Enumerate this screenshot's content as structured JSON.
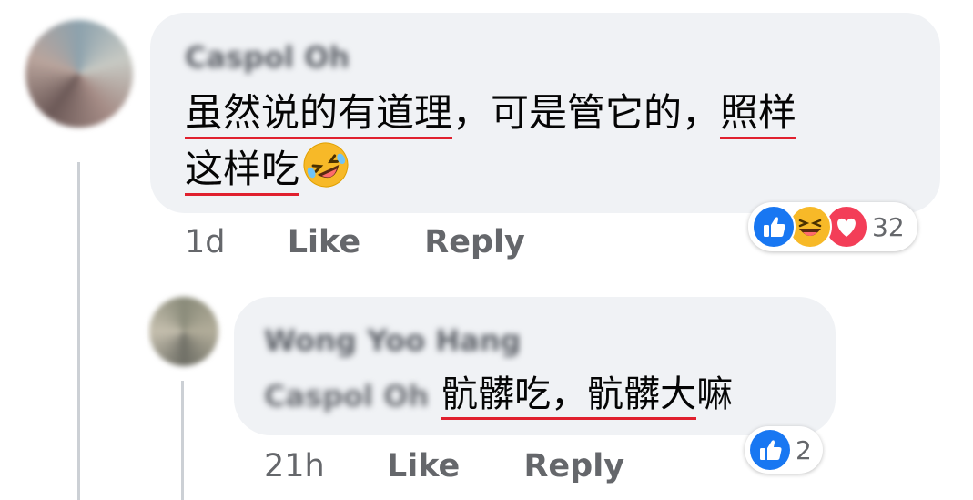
{
  "comment": {
    "author": "Caspol Oh",
    "text_parts": [
      "虽然说的有道理",
      "，可是管它的，",
      "照样",
      "这样吃"
    ],
    "emoji": "rolling-on-floor-laughing",
    "time": "1d",
    "like_label": "Like",
    "reply_label": "Reply",
    "reaction_count": "32",
    "reactions": [
      "like",
      "haha",
      "love"
    ]
  },
  "reply": {
    "author": "Wong Yoo Hang",
    "mention": "Caspol Oh",
    "text_parts": [
      "骯髒吃，骯髒大",
      "嘛"
    ],
    "time": "21h",
    "like_label": "Like",
    "reply_label": "Reply",
    "reaction_count": "2",
    "reactions": [
      "like"
    ]
  },
  "colors": {
    "bubble": "#f0f2f5",
    "underline": "#e0202e",
    "like_blue": "#1877f2",
    "love_red": "#f33e58",
    "haha_yellow": "#f7b928"
  }
}
